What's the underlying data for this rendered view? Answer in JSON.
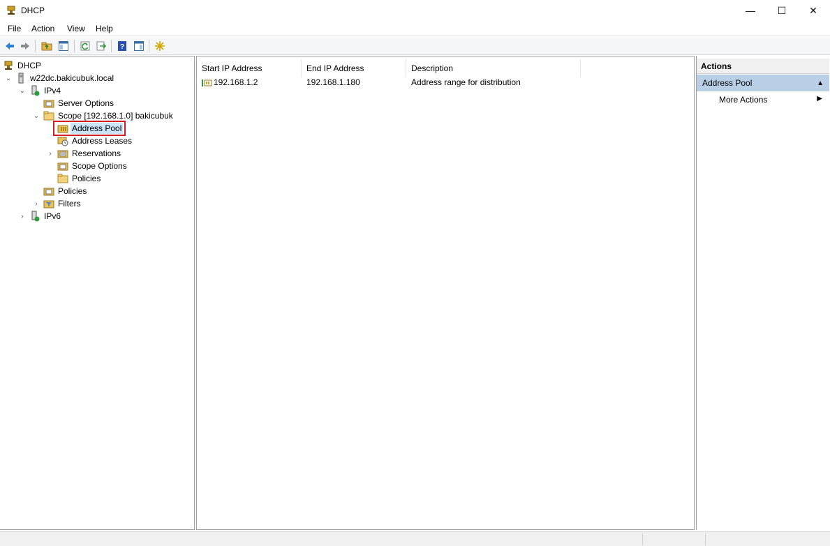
{
  "window": {
    "title": "DHCP",
    "controls": {
      "minimize": "—",
      "maximize": "☐",
      "close": "✕"
    }
  },
  "menu": {
    "items": [
      "File",
      "Action",
      "View",
      "Help"
    ]
  },
  "toolbar": {
    "buttons": [
      "back-icon",
      "forward-icon",
      "up-folder-icon",
      "show-hide-console-tree-icon",
      "refresh-icon",
      "export-list-icon",
      "help-icon",
      "show-hide-action-pane-icon",
      "new-star-icon"
    ]
  },
  "tree": {
    "root": "DHCP",
    "server": "w22dc.bakicubuk.local",
    "ipv4": "IPv4",
    "server_options": "Server Options",
    "scope": "Scope [192.168.1.0] bakicubuk",
    "address_pool": "Address Pool",
    "address_leases": "Address Leases",
    "reservations": "Reservations",
    "scope_options": "Scope Options",
    "scope_policies": "Policies",
    "policies": "Policies",
    "filters": "Filters",
    "ipv6": "IPv6"
  },
  "list": {
    "columns": [
      "Start IP Address",
      "End IP Address",
      "Description"
    ],
    "rows": [
      {
        "start": "192.168.1.2",
        "end": "192.168.1.180",
        "description": "Address range for distribution"
      }
    ]
  },
  "actions": {
    "header": "Actions",
    "section": "Address Pool",
    "more_actions": "More Actions"
  },
  "colors": {
    "selection_highlight": "#d21f26",
    "actions_section_bg": "#b9cfe6"
  }
}
